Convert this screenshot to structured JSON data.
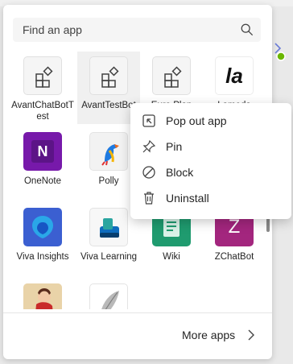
{
  "search": {
    "placeholder": "Find an app"
  },
  "apps": [
    {
      "label": "AvantChatBotTest"
    },
    {
      "label": "AvantTestBot"
    },
    {
      "label": "Euro Plan"
    },
    {
      "label": "Lameda",
      "icon_text": "la"
    },
    {
      "label": "OneNote",
      "icon_text": "N"
    },
    {
      "label": "Polly"
    },
    {
      "label": "Viva Insights"
    },
    {
      "label": "Viva Learning"
    },
    {
      "label": "Wiki"
    },
    {
      "label": "ZChatBot",
      "icon_text": "Z"
    }
  ],
  "context_menu": {
    "items": [
      {
        "label": "Pop out app",
        "icon": "pop-out-icon"
      },
      {
        "label": "Pin",
        "icon": "pin-icon"
      },
      {
        "label": "Block",
        "icon": "block-icon"
      },
      {
        "label": "Uninstall",
        "icon": "trash-icon"
      }
    ]
  },
  "footer": {
    "more_apps_label": "More apps"
  },
  "colors": {
    "onenote": "#7719aa",
    "zchatbot": "#a3267e",
    "wiki": "#1f9b6f",
    "viva_insights": "#3b5fd1",
    "lameda": "#ffffff"
  }
}
